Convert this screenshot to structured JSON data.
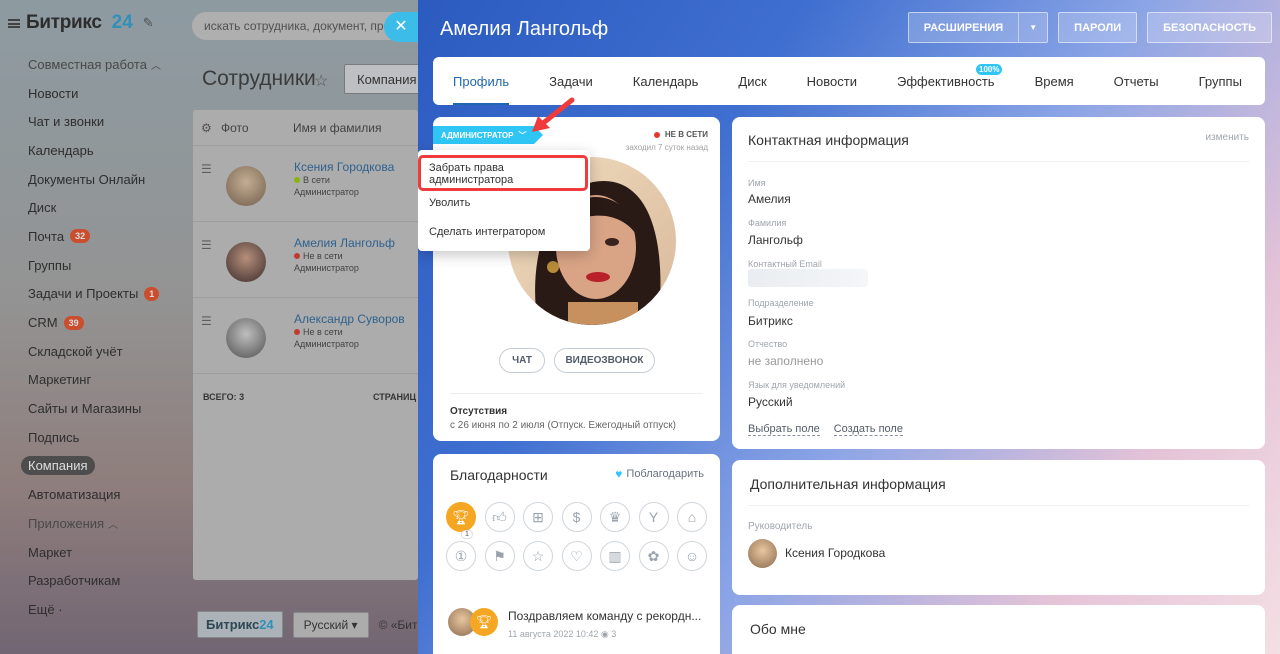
{
  "background": {
    "logo_text": "Битрикс",
    "logo_number": "24",
    "menu": [
      {
        "label": "Совместная работа",
        "group": true
      },
      {
        "label": "Новости"
      },
      {
        "label": "Чат и звонки"
      },
      {
        "label": "Календарь"
      },
      {
        "label": "Документы Онлайн"
      },
      {
        "label": "Диск"
      },
      {
        "label": "Почта",
        "badge": "32"
      },
      {
        "label": "Группы"
      },
      {
        "label": "Задачи и Проекты",
        "badge": "1"
      },
      {
        "label": "CRM",
        "badge": "39"
      },
      {
        "label": "Складской учёт"
      },
      {
        "label": "Маркетинг"
      },
      {
        "label": "Сайты и Магазины"
      },
      {
        "label": "Подпись"
      },
      {
        "label": "Компания",
        "active": true
      },
      {
        "label": "Автоматизация"
      },
      {
        "label": "Приложения",
        "group": true
      },
      {
        "label": "Маркет"
      },
      {
        "label": "Разработчикам"
      },
      {
        "label": "Ещё ·"
      }
    ],
    "search_placeholder": "искать сотрудника, документ, проч",
    "page_title": "Сотрудники",
    "filter_tab": "Компания",
    "table": {
      "col_photo": "Фото",
      "col_name": "Имя и фамилия",
      "rows": [
        {
          "name": "Ксения Городкова",
          "status": "В сети",
          "role": "Администратор",
          "status_color": "#9dcf00"
        },
        {
          "name": "Амелия Лангольф",
          "status": "Не в сети",
          "role": "Администратор",
          "status_color": "#e0392c"
        },
        {
          "name": "Александр Суворов",
          "status": "Не в сети",
          "role": "Администратор",
          "status_color": "#e0392c"
        }
      ],
      "total": "ВСЕГО: 3",
      "pages": "СТРАНИЦ"
    },
    "footer": {
      "b24_text": "Битрикс",
      "b24_num": "24",
      "lang": "Русский",
      "copyright": "© «Битр"
    }
  },
  "slider": {
    "title": "Амелия Лангольф",
    "buttons": {
      "extensions": "РАСШИРЕНИЯ",
      "passwords": "ПАРОЛИ",
      "security": "БЕЗОПАСНОСТЬ"
    },
    "tabs": [
      "Профиль",
      "Задачи",
      "Календарь",
      "Диск",
      "Новости",
      "Эффективность",
      "Время",
      "Отчеты",
      "Группы"
    ],
    "efficiency_badge": "100%",
    "profile": {
      "admin_tag": "АДМИНИСТРАТОР",
      "status": "НЕ В СЕТИ",
      "last_visit": "заходил 7 суток назад",
      "btn_chat": "ЧАТ",
      "btn_video": "ВИДЕОЗВОНОК",
      "absence_title": "Отсутствия",
      "absence_text": "с 26 июня по 2 июля (Отпуск. Ежегодный отпуск)"
    },
    "dropdown": [
      "Забрать права администратора",
      "Уволить",
      "Сделать интегратором"
    ],
    "thanks": {
      "title": "Благодарности",
      "action": "Поблагодарить",
      "selected_count": "1",
      "news_text": "Поздравляем команду с рекордн...",
      "news_date": "11 августа 2022 10:42",
      "news_views": "3"
    },
    "contact": {
      "title": "Контактная информация",
      "edit": "изменить",
      "fields": [
        {
          "label": "Имя",
          "value": "Амелия"
        },
        {
          "label": "Фамилия",
          "value": "Лангольф"
        },
        {
          "label": "Контактный Email",
          "value": ""
        },
        {
          "label": "Подразделение",
          "value": "Битрикс"
        },
        {
          "label": "Отчество",
          "value": "не заполнено"
        },
        {
          "label": "Язык для уведомлений",
          "value": "Русский"
        }
      ],
      "link_choose": "Выбрать поле",
      "link_create": "Создать поле"
    },
    "extra": {
      "title": "Дополнительная информация",
      "manager_label": "Руководитель",
      "manager_name": "Ксения Городкова"
    },
    "about": {
      "title": "Обо мне"
    }
  }
}
